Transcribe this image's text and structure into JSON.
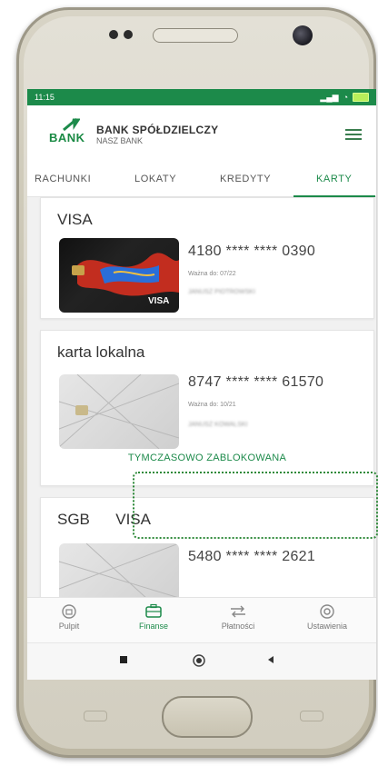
{
  "status_bar": {
    "time": "11:15"
  },
  "header": {
    "logo_text": "BANK",
    "bank_name": "BANK SPÓŁDZIELCZY",
    "bank_subtitle": "NASZ BANK"
  },
  "tabs": [
    {
      "label": "RACHUNKI"
    },
    {
      "label": "LOKATY"
    },
    {
      "label": "KREDYTY"
    },
    {
      "label": "KARTY"
    }
  ],
  "cards": [
    {
      "title": "VISA",
      "number": "4180 **** **** 0390",
      "validity": "Ważna do: 07/22",
      "owner": "JANUSZ PIOTROWSKI"
    },
    {
      "title": "karta lokalna",
      "number": "8747 **** **** 61570",
      "validity": "Ważna do: 10/21",
      "owner": "JANUSZ KOWALSKI",
      "status": "TYMCZASOWO ZABLOKOWANA"
    },
    {
      "title": "SGB      VISA",
      "number": "5480 **** **** 2621"
    }
  ],
  "bottom_nav": [
    {
      "label": "Pulpit",
      "icon": "home-icon"
    },
    {
      "label": "Finanse",
      "icon": "wallet-icon"
    },
    {
      "label": "Płatności",
      "icon": "transfer-icon"
    },
    {
      "label": "Ustawienia",
      "icon": "settings-icon"
    }
  ],
  "colors": {
    "brand_green": "#1c8a4a",
    "status_bar": "#1c8a4a"
  }
}
